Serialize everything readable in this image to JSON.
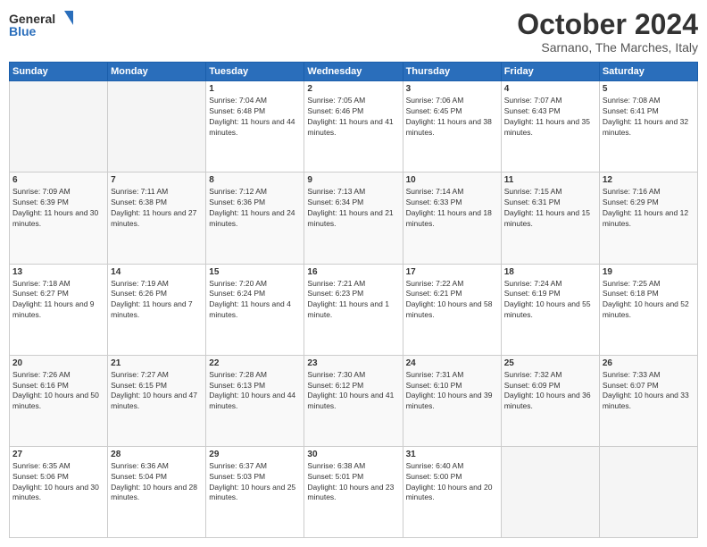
{
  "header": {
    "logo_line1": "General",
    "logo_line2": "Blue",
    "month": "October 2024",
    "location": "Sarnano, The Marches, Italy"
  },
  "days_of_week": [
    "Sunday",
    "Monday",
    "Tuesday",
    "Wednesday",
    "Thursday",
    "Friday",
    "Saturday"
  ],
  "weeks": [
    [
      {
        "num": "",
        "info": ""
      },
      {
        "num": "",
        "info": ""
      },
      {
        "num": "1",
        "info": "Sunrise: 7:04 AM\nSunset: 6:48 PM\nDaylight: 11 hours and 44 minutes."
      },
      {
        "num": "2",
        "info": "Sunrise: 7:05 AM\nSunset: 6:46 PM\nDaylight: 11 hours and 41 minutes."
      },
      {
        "num": "3",
        "info": "Sunrise: 7:06 AM\nSunset: 6:45 PM\nDaylight: 11 hours and 38 minutes."
      },
      {
        "num": "4",
        "info": "Sunrise: 7:07 AM\nSunset: 6:43 PM\nDaylight: 11 hours and 35 minutes."
      },
      {
        "num": "5",
        "info": "Sunrise: 7:08 AM\nSunset: 6:41 PM\nDaylight: 11 hours and 32 minutes."
      }
    ],
    [
      {
        "num": "6",
        "info": "Sunrise: 7:09 AM\nSunset: 6:39 PM\nDaylight: 11 hours and 30 minutes."
      },
      {
        "num": "7",
        "info": "Sunrise: 7:11 AM\nSunset: 6:38 PM\nDaylight: 11 hours and 27 minutes."
      },
      {
        "num": "8",
        "info": "Sunrise: 7:12 AM\nSunset: 6:36 PM\nDaylight: 11 hours and 24 minutes."
      },
      {
        "num": "9",
        "info": "Sunrise: 7:13 AM\nSunset: 6:34 PM\nDaylight: 11 hours and 21 minutes."
      },
      {
        "num": "10",
        "info": "Sunrise: 7:14 AM\nSunset: 6:33 PM\nDaylight: 11 hours and 18 minutes."
      },
      {
        "num": "11",
        "info": "Sunrise: 7:15 AM\nSunset: 6:31 PM\nDaylight: 11 hours and 15 minutes."
      },
      {
        "num": "12",
        "info": "Sunrise: 7:16 AM\nSunset: 6:29 PM\nDaylight: 11 hours and 12 minutes."
      }
    ],
    [
      {
        "num": "13",
        "info": "Sunrise: 7:18 AM\nSunset: 6:27 PM\nDaylight: 11 hours and 9 minutes."
      },
      {
        "num": "14",
        "info": "Sunrise: 7:19 AM\nSunset: 6:26 PM\nDaylight: 11 hours and 7 minutes."
      },
      {
        "num": "15",
        "info": "Sunrise: 7:20 AM\nSunset: 6:24 PM\nDaylight: 11 hours and 4 minutes."
      },
      {
        "num": "16",
        "info": "Sunrise: 7:21 AM\nSunset: 6:23 PM\nDaylight: 11 hours and 1 minute."
      },
      {
        "num": "17",
        "info": "Sunrise: 7:22 AM\nSunset: 6:21 PM\nDaylight: 10 hours and 58 minutes."
      },
      {
        "num": "18",
        "info": "Sunrise: 7:24 AM\nSunset: 6:19 PM\nDaylight: 10 hours and 55 minutes."
      },
      {
        "num": "19",
        "info": "Sunrise: 7:25 AM\nSunset: 6:18 PM\nDaylight: 10 hours and 52 minutes."
      }
    ],
    [
      {
        "num": "20",
        "info": "Sunrise: 7:26 AM\nSunset: 6:16 PM\nDaylight: 10 hours and 50 minutes."
      },
      {
        "num": "21",
        "info": "Sunrise: 7:27 AM\nSunset: 6:15 PM\nDaylight: 10 hours and 47 minutes."
      },
      {
        "num": "22",
        "info": "Sunrise: 7:28 AM\nSunset: 6:13 PM\nDaylight: 10 hours and 44 minutes."
      },
      {
        "num": "23",
        "info": "Sunrise: 7:30 AM\nSunset: 6:12 PM\nDaylight: 10 hours and 41 minutes."
      },
      {
        "num": "24",
        "info": "Sunrise: 7:31 AM\nSunset: 6:10 PM\nDaylight: 10 hours and 39 minutes."
      },
      {
        "num": "25",
        "info": "Sunrise: 7:32 AM\nSunset: 6:09 PM\nDaylight: 10 hours and 36 minutes."
      },
      {
        "num": "26",
        "info": "Sunrise: 7:33 AM\nSunset: 6:07 PM\nDaylight: 10 hours and 33 minutes."
      }
    ],
    [
      {
        "num": "27",
        "info": "Sunrise: 6:35 AM\nSunset: 5:06 PM\nDaylight: 10 hours and 30 minutes."
      },
      {
        "num": "28",
        "info": "Sunrise: 6:36 AM\nSunset: 5:04 PM\nDaylight: 10 hours and 28 minutes."
      },
      {
        "num": "29",
        "info": "Sunrise: 6:37 AM\nSunset: 5:03 PM\nDaylight: 10 hours and 25 minutes."
      },
      {
        "num": "30",
        "info": "Sunrise: 6:38 AM\nSunset: 5:01 PM\nDaylight: 10 hours and 23 minutes."
      },
      {
        "num": "31",
        "info": "Sunrise: 6:40 AM\nSunset: 5:00 PM\nDaylight: 10 hours and 20 minutes."
      },
      {
        "num": "",
        "info": ""
      },
      {
        "num": "",
        "info": ""
      }
    ]
  ]
}
